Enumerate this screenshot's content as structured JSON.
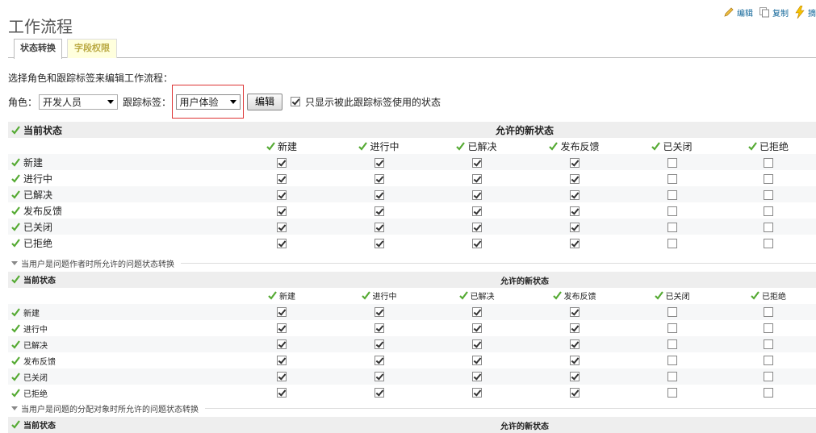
{
  "page": {
    "title": "工作流程"
  },
  "contextual": {
    "edit": "编辑",
    "copy": "复制",
    "summary": "摘"
  },
  "tabs": [
    {
      "label": "状态转换",
      "selected": true
    },
    {
      "label": "字段权限",
      "selected": false
    }
  ],
  "intro": "选择角色和跟踪标签来编辑工作流程：",
  "filters": {
    "role_label": "角色：",
    "role_value": "开发人员",
    "tracker_label": "跟踪标签：",
    "tracker_value": "用户体验",
    "edit_button": "编辑",
    "only_used_label": "只显示被此跟踪标签使用的状态",
    "only_used_checked": true
  },
  "statuses": [
    "新建",
    "进行中",
    "已解决",
    "发布反馈",
    "已关闭",
    "已拒绝"
  ],
  "tables": [
    {
      "current_label": "当前状态",
      "allowed_label": "允许的新状态",
      "rows": [
        {
          "name": "新建",
          "checks": [
            true,
            true,
            true,
            true,
            false,
            false
          ]
        },
        {
          "name": "进行中",
          "checks": [
            true,
            true,
            true,
            true,
            false,
            false
          ]
        },
        {
          "name": "已解决",
          "checks": [
            true,
            true,
            true,
            true,
            false,
            false
          ]
        },
        {
          "name": "发布反馈",
          "checks": [
            true,
            true,
            true,
            true,
            false,
            false
          ]
        },
        {
          "name": "已关闭",
          "checks": [
            true,
            true,
            true,
            true,
            false,
            false
          ]
        },
        {
          "name": "已拒绝",
          "checks": [
            true,
            true,
            true,
            true,
            false,
            false
          ]
        }
      ]
    },
    {
      "legend": "当用户是问题作者时所允许的问题状态转换",
      "current_label": "当前状态",
      "allowed_label": "允许的新状态",
      "rows": [
        {
          "name": "新建",
          "checks": [
            true,
            true,
            true,
            true,
            false,
            false
          ]
        },
        {
          "name": "进行中",
          "checks": [
            true,
            true,
            true,
            true,
            false,
            false
          ]
        },
        {
          "name": "已解决",
          "checks": [
            true,
            true,
            true,
            true,
            false,
            false
          ]
        },
        {
          "name": "发布反馈",
          "checks": [
            true,
            true,
            true,
            true,
            false,
            false
          ]
        },
        {
          "name": "已关闭",
          "checks": [
            true,
            true,
            true,
            true,
            false,
            false
          ]
        },
        {
          "name": "已拒绝",
          "checks": [
            true,
            true,
            true,
            true,
            false,
            false
          ]
        }
      ]
    },
    {
      "legend": "当用户是问题的分配对象时所允许的问题状态转换",
      "current_label": "当前状态",
      "allowed_label": "允许的新状态",
      "rows": []
    }
  ],
  "colors": {
    "tick": "#55aa33",
    "header_bg": "#eeeeee",
    "highlight": "#dd3333",
    "link": "#116699"
  }
}
